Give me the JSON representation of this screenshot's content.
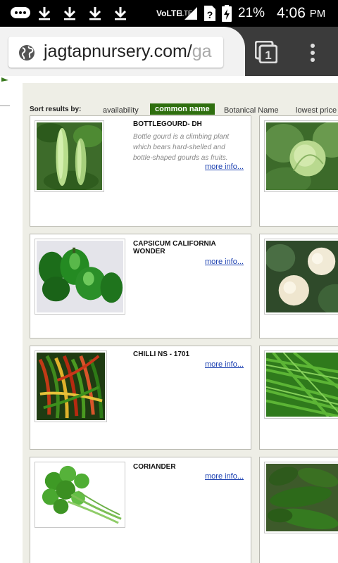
{
  "status_bar": {
    "network": "VoLTE",
    "lte": "LTE",
    "battery": "21%",
    "time": "4:06",
    "ampm": "PM"
  },
  "browser": {
    "url_main": "jagtapnursery.com/",
    "url_faded": "ga",
    "tab_count": "1"
  },
  "sort": {
    "label": "Sort results by:",
    "options": [
      "availability",
      "common name",
      "Botanical Name",
      "lowest price"
    ]
  },
  "products": [
    {
      "name": "BOTTLEGOURD- DH",
      "desc": "Bottle gourd is a climbing plant which bears hard-shelled and bottle-shaped gourds as fruits.",
      "link": "more info..."
    },
    {
      "name": "CAPSICUM CALIFORNIA WONDER",
      "desc": "",
      "link": "more info..."
    },
    {
      "name": "CHILLI NS - 1701",
      "desc": "",
      "link": "more info..."
    },
    {
      "name": "CORIANDER",
      "desc": "",
      "link": "more info..."
    }
  ]
}
